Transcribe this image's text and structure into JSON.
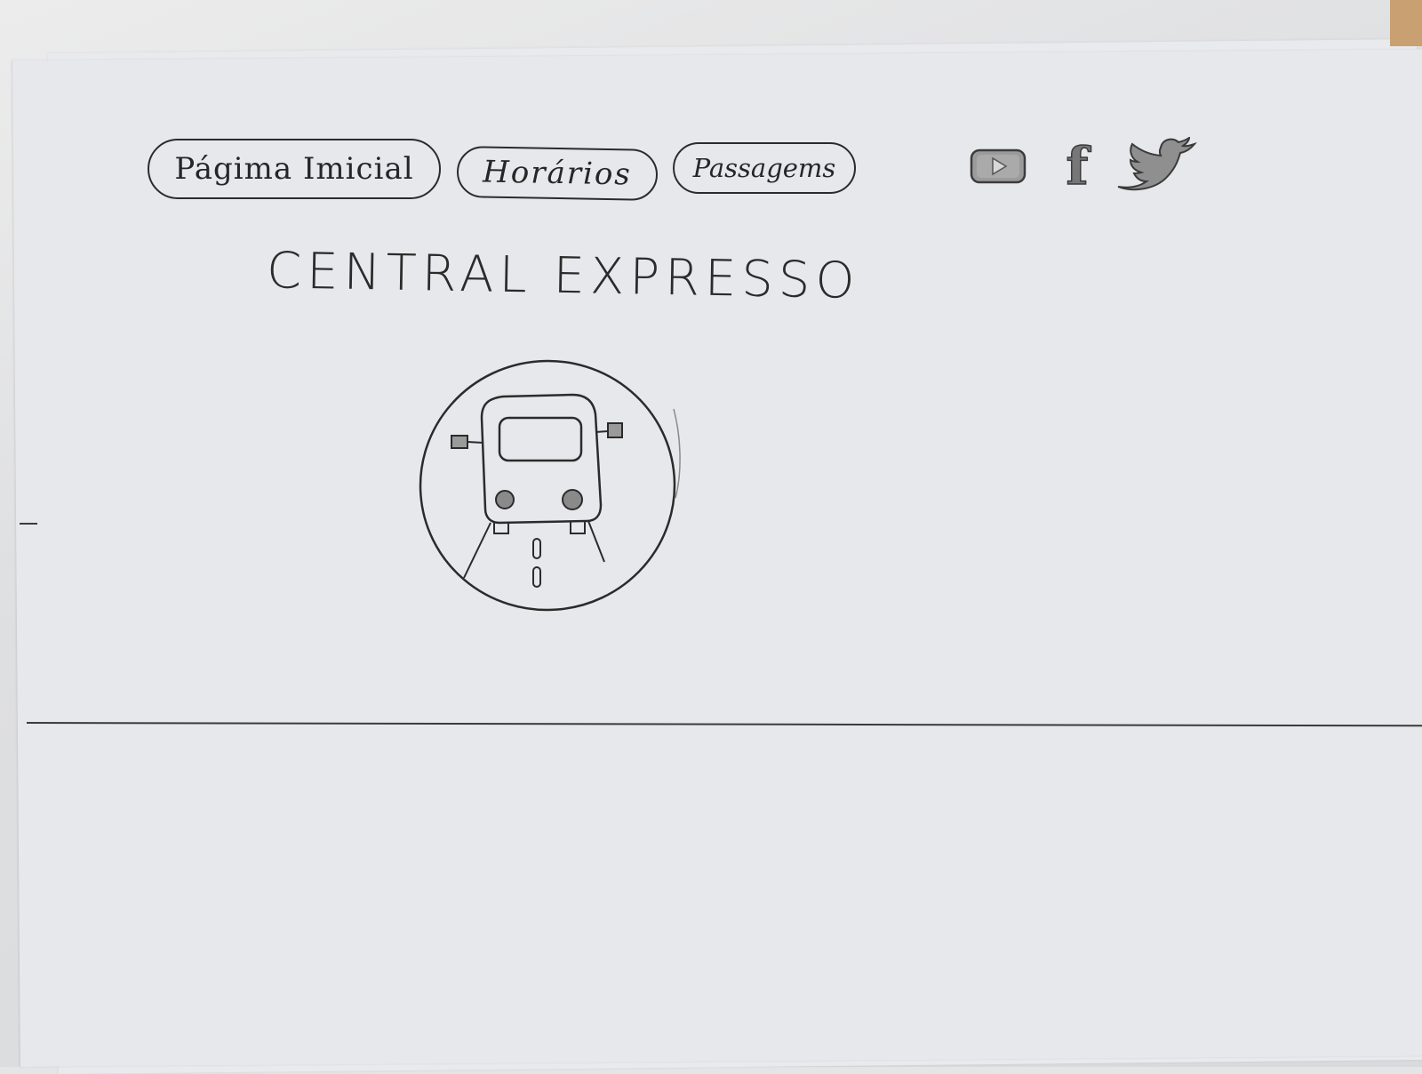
{
  "nav": {
    "items": [
      {
        "label": "Págima Imicial"
      },
      {
        "label": "Horários"
      },
      {
        "label": "Passagems"
      }
    ]
  },
  "header": {
    "title": "CENTRAL EXPRESSO"
  },
  "social": {
    "icons": [
      "youtube-icon",
      "facebook-icon",
      "twitter-icon"
    ],
    "facebook_glyph": "f"
  },
  "colors": {
    "ink": "#2b2b2b",
    "paper": "#e7e8ec",
    "pencil_fill": "#8a8a8a"
  }
}
